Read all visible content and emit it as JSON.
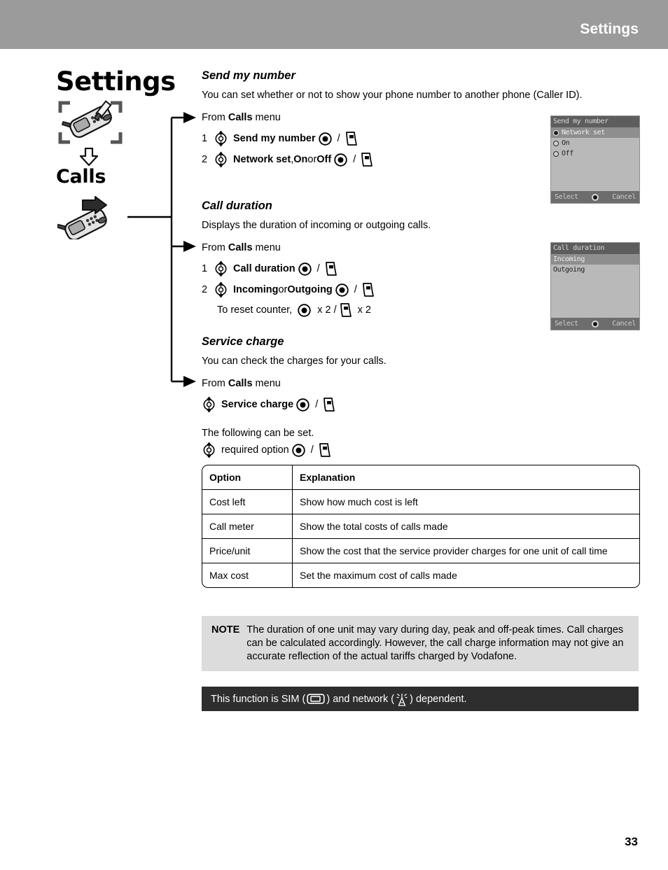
{
  "header": {
    "title": "Settings"
  },
  "sidebar": {
    "chapter_title": "Settings",
    "sub_title": "Calls",
    "icons": {
      "phone_tool": "phone-with-screwdriver-icon",
      "down_arrow": "down-arrow-icon",
      "phone_arrow": "phone-with-right-arrow-icon"
    }
  },
  "sections": [
    {
      "id": "send-my-number",
      "heading": "Send my number",
      "description": "You can set whether or not to show your phone number to another phone (Caller ID).",
      "from_prefix": "From ",
      "from_menu": "Calls",
      "from_suffix": " menu",
      "steps": [
        {
          "num": "1",
          "label": "Send my number",
          "tail": ""
        },
        {
          "num": "2",
          "label": "Network set",
          "mid1": ", ",
          "label2": "On",
          "mid2": " or ",
          "label3": "Off"
        }
      ]
    },
    {
      "id": "call-duration",
      "heading": "Call duration",
      "description": "Displays the duration of incoming or outgoing calls.",
      "from_prefix": "From ",
      "from_menu": "Calls",
      "from_suffix": " menu",
      "steps": [
        {
          "num": "1",
          "label": "Call duration"
        },
        {
          "num": "2",
          "label": "Incoming",
          "mid": " or ",
          "label2": "Outgoing"
        }
      ],
      "reset_text": "To reset counter,",
      "reset_x1": "x 2 /",
      "reset_x2": "x 2"
    },
    {
      "id": "service-charge",
      "heading": "Service charge",
      "description": "You can check the charges for your calls.",
      "from_prefix": "From ",
      "from_menu": "Calls",
      "from_suffix": " menu",
      "step_label": "Service charge",
      "following_text": "The following can be set.",
      "required_label": "required option"
    }
  ],
  "screenshots": [
    {
      "id": "send-my-number-shot",
      "title": "Send my number",
      "rows": [
        {
          "text": "Network set",
          "selected": true,
          "radio": "on"
        },
        {
          "text": "On",
          "selected": false,
          "radio": "off"
        },
        {
          "text": "Off",
          "selected": false,
          "radio": "off"
        }
      ],
      "left_key": "Select",
      "right_key": "Cancel"
    },
    {
      "id": "call-duration-shot",
      "title": "Call duration",
      "rows": [
        {
          "text": "Incoming",
          "selected": true,
          "radio": "none"
        },
        {
          "text": "Outgoing",
          "selected": false,
          "radio": "none"
        }
      ],
      "left_key": "Select",
      "right_key": "Cancel"
    }
  ],
  "options_table": {
    "headers": [
      "Option",
      "Explanation"
    ],
    "rows": [
      [
        "Cost left",
        "Show how much cost is left"
      ],
      [
        "Call meter",
        "Show the total costs of calls made"
      ],
      [
        "Price/unit",
        "Show the cost that the service provider charges for one unit of call time"
      ],
      [
        "Max cost",
        "Set the maximum cost of calls made"
      ]
    ]
  },
  "note": {
    "label": "NOTE",
    "text": "The duration of one unit may vary during day, peak and off-peak times. Call charges can be calculated accordingly. However, the call charge information may not give an accurate reflection of the actual tariffs charged by Vodafone."
  },
  "dependency_bar": {
    "part1": "This function is SIM (",
    "part2": ") and network (",
    "part3": ") dependent."
  },
  "page_number": "33",
  "colors": {
    "header_band": "#9b9b9b",
    "note_bg": "#dcdcdc",
    "dep_bar_bg": "#2e2e2e",
    "screen_bg": "#b9b9b9"
  }
}
